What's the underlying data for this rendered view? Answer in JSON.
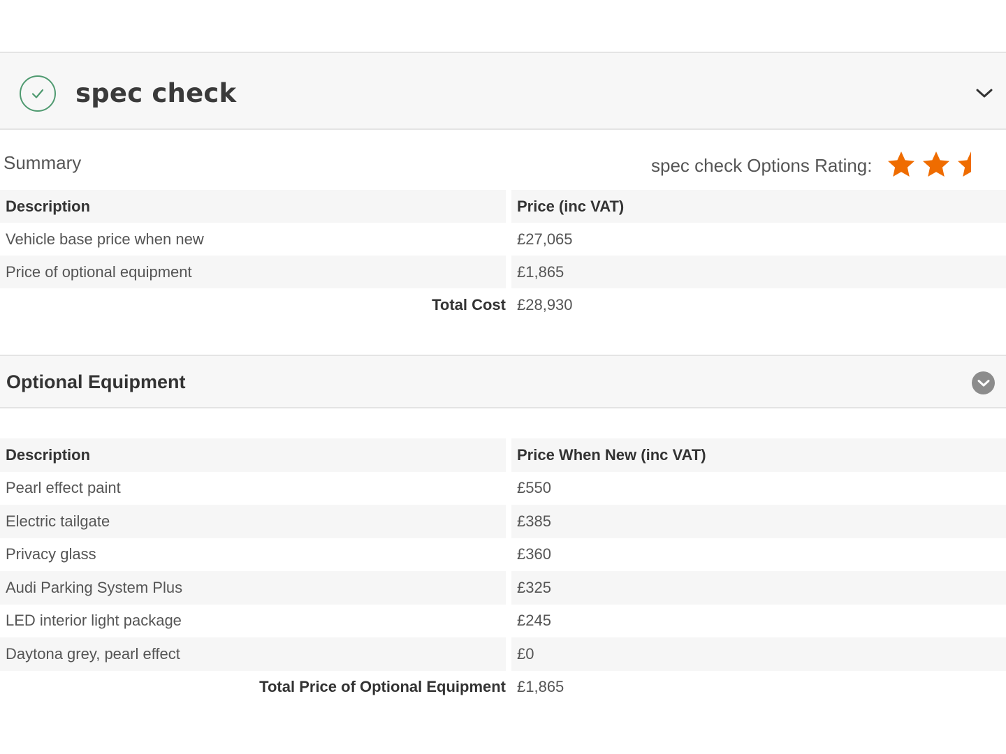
{
  "spec": {
    "title": "spec check",
    "summary_label": "Summary",
    "rating_label": "spec check Options Rating:",
    "rating_stars": 2.5,
    "rating_max": 3,
    "accent_color": "#ef6c00",
    "check_color": "#4f9a70"
  },
  "summary_table": {
    "headers": [
      "Description",
      "Price (inc VAT)"
    ],
    "rows": [
      {
        "description": "Vehicle base price when new",
        "price": "£27,065"
      },
      {
        "description": "Price of optional equipment",
        "price": "£1,865"
      }
    ],
    "total_label": "Total Cost",
    "total_value": "£28,930"
  },
  "optional_section": {
    "title": "Optional Equipment"
  },
  "optional_table": {
    "headers": [
      "Description",
      "Price When New (inc VAT)"
    ],
    "rows": [
      {
        "description": "Pearl effect paint",
        "price": "£550"
      },
      {
        "description": "Electric tailgate",
        "price": "£385"
      },
      {
        "description": "Privacy glass",
        "price": "£360"
      },
      {
        "description": "Audi Parking System Plus",
        "price": "£325"
      },
      {
        "description": "LED interior light package",
        "price": "£245"
      },
      {
        "description": "Daytona grey, pearl effect",
        "price": "£0"
      }
    ],
    "total_label": "Total Price of Optional Equipment",
    "total_value": "£1,865"
  }
}
